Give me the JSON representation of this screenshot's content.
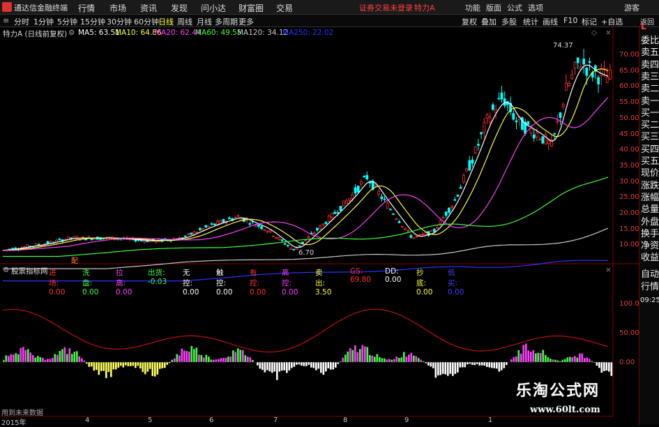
{
  "menu": {
    "app_name": "通达信金融终端",
    "items": [
      "行情",
      "市场",
      "资讯",
      "发现",
      "问小达",
      "财富圈",
      "交易"
    ],
    "login_status": "证券交易未登录",
    "stock_title": "特力A",
    "right_items": [
      "功能",
      "版面",
      "公式",
      "选项"
    ],
    "guest": "游客"
  },
  "periods": [
    "分时",
    "1分钟",
    "5分钟",
    "15分钟",
    "30分钟",
    "60分钟",
    "日线",
    "周线",
    "月线",
    "多周期",
    "更多"
  ],
  "active_period": "日线",
  "tools": [
    "复权",
    "叠加",
    "多股",
    "统计",
    "画线",
    "F10",
    "标记",
    "+自选",
    "返回"
  ],
  "info": {
    "title": "特力A (日线前复权)",
    "ma5": "MA5: 63.51",
    "ma10": "MA10: 64.86",
    "ma20": "MA20: 62.44",
    "ma60": "MA60: 49.55",
    "ma120": "MA120: 34.12",
    "ma250": "MA250: 22.02"
  },
  "price_axis": [
    "70.00",
    "65.00",
    "60.00",
    "55.00",
    "50.00",
    "45.00",
    "40.00",
    "35.00",
    "30.00",
    "25.00",
    "20.00",
    "15.00",
    "10.00"
  ],
  "annotations": {
    "high": "74.37",
    "low": "6.70",
    "tag": "配"
  },
  "indicator": {
    "name": "股票指标网",
    "fields": [
      {
        "label": "进场: 0.00",
        "color": "#ff3030"
      },
      {
        "label": "洗盘: 0.00",
        "color": "#40ff40"
      },
      {
        "label": "拉高: 0.00",
        "color": "#ff40ff"
      },
      {
        "label": "出货: -0.03",
        "color": "#40ff40"
      },
      {
        "label": "无控: 0.00",
        "color": "#ffffff"
      },
      {
        "label": "触控: 0.00",
        "color": "#ffffff"
      },
      {
        "label": "有控: 0.00",
        "color": "#ff3030"
      },
      {
        "label": "高控: 0.00",
        "color": "#ff40ff"
      },
      {
        "label": "卖出: 3.50",
        "color": "#ffff40"
      },
      {
        "label": "GS: 69.80",
        "color": "#ff3030"
      },
      {
        "label": "DD: 0.00",
        "color": "#ffffff"
      },
      {
        "label": "抄底: 0.00",
        "color": "#ffff40"
      },
      {
        "label": "低买: 0.00",
        "color": "#4040ff"
      }
    ],
    "axis": [
      "100.00",
      "50.00",
      "0.00"
    ],
    "hint": "用到未来数据"
  },
  "right_panel": [
    "委比",
    "卖五",
    "卖四",
    "卖三",
    "卖二",
    "卖一",
    "买一",
    "买二",
    "买三",
    "买四",
    "买五",
    "现价",
    "涨跌",
    "涨幅",
    "总量",
    "外盘",
    "换手",
    "净资",
    "收益",
    "自动",
    "行情"
  ],
  "right_panel_top": "L",
  "clock": "09:25",
  "time_axis": [
    "2015年",
    "4",
    "5",
    "6",
    "7",
    "8",
    "9",
    "1"
  ],
  "watermark": {
    "title": "乐淘公式网",
    "url": "www.60lt.com"
  }
}
